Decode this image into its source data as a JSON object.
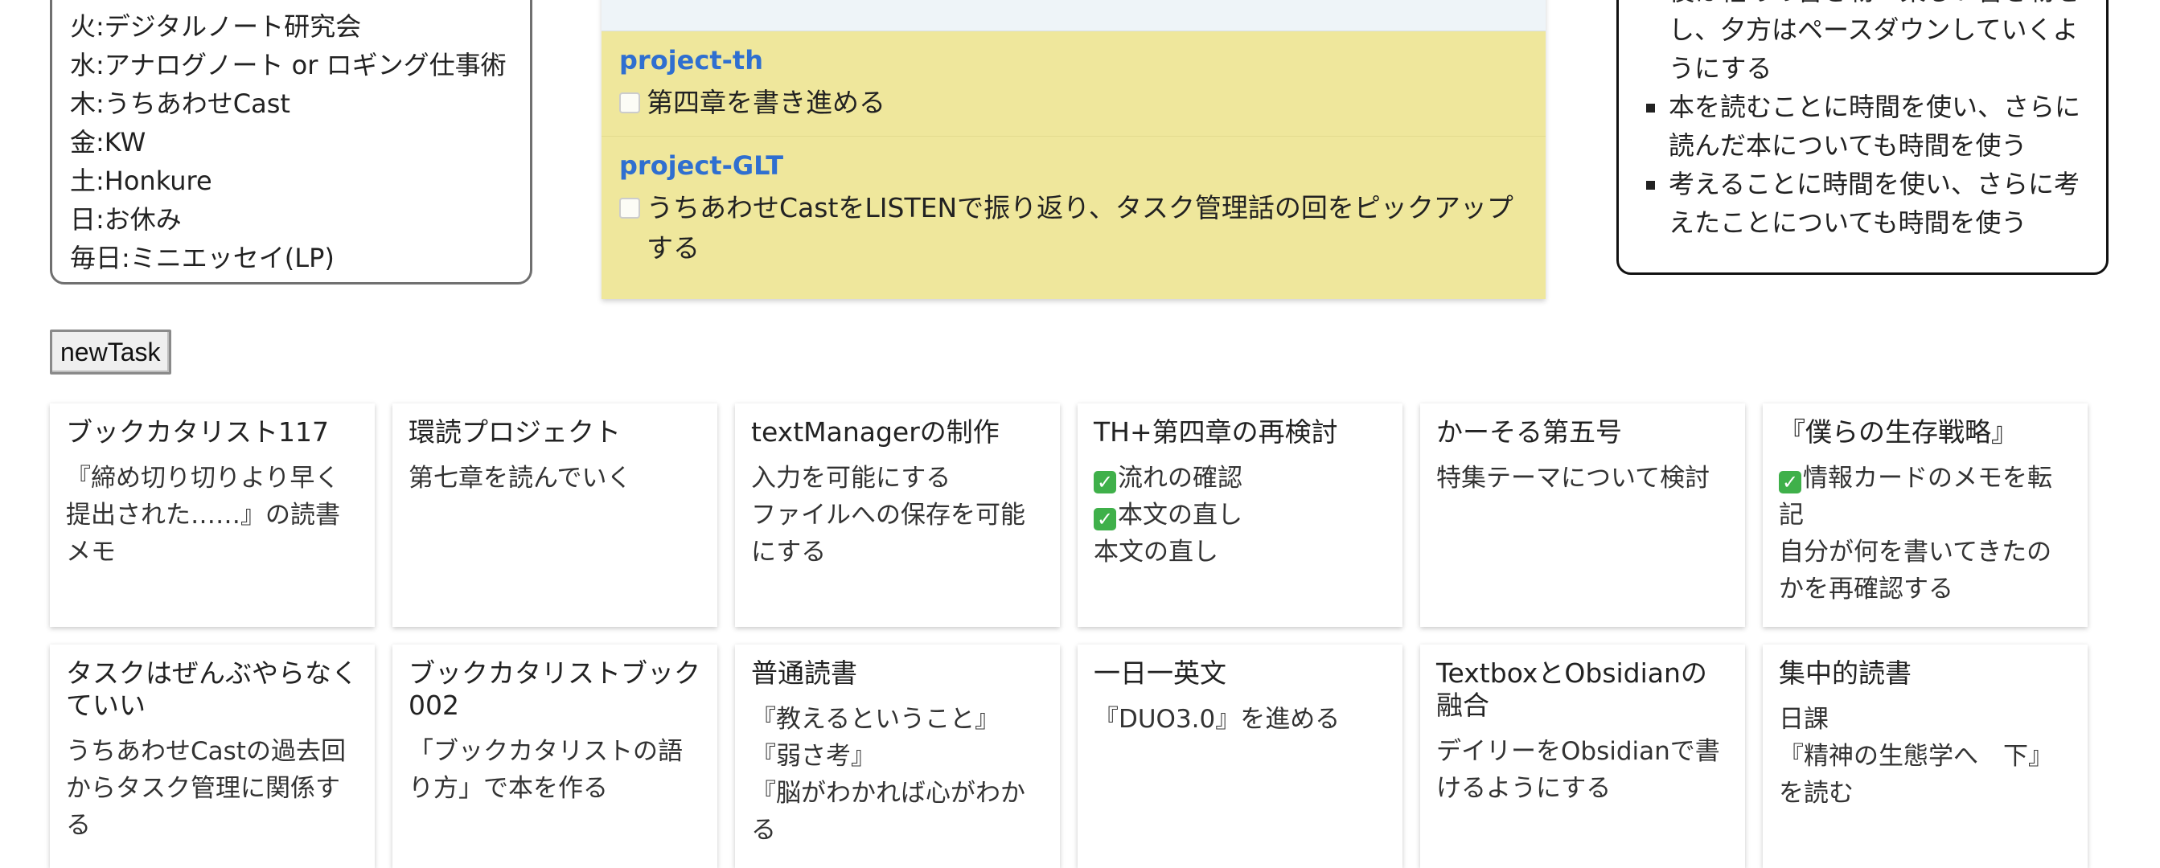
{
  "schedule": {
    "lines": [
      "火:デジタルノート研究会",
      "水:アナログノート or ロギング仕事術",
      "木:うちあわせCast",
      "金:KW",
      "土:Honkure",
      "日:お休み",
      "毎日:ミニエッセイ(LP)"
    ]
  },
  "projects": [
    {
      "name": "project-th",
      "task": "第四章を書き進める"
    },
    {
      "name": "project-GLT",
      "task": "うちあわせCastをLISTENで振り返り、タスク管理話の回をピックアップする"
    }
  ],
  "policy": {
    "items": [
      "後は軽めの書き物・楽しい書き物をし、夕方はペースダウンしていくようにする",
      "本を読むことに時間を使い、さらに読んだ本についても時間を使う",
      "考えることに時間を使い、さらに考えたことについても時間を使う"
    ]
  },
  "toolbar": {
    "new_task_label": "newTask"
  },
  "done_icon": {
    "glyph": "✓",
    "color": "#3fb04a"
  },
  "cards": [
    {
      "title": "ブックカタリスト117",
      "lines": [
        {
          "text": "『締め切り切りより早く提出された……』の読書メモ"
        }
      ]
    },
    {
      "title": "環読プロジェクト",
      "lines": [
        {
          "text": "第七章を読んでいく"
        }
      ]
    },
    {
      "title": "textManagerの制作",
      "lines": [
        {
          "text": "入力を可能にする"
        },
        {
          "text": "ファイルへの保存を可能にする"
        }
      ]
    },
    {
      "title": "TH+第四章の再検討",
      "lines": [
        {
          "text": "流れの確認",
          "done": true
        },
        {
          "text": "本文の直し",
          "done": true
        },
        {
          "text": "本文の直し"
        }
      ]
    },
    {
      "title": "かーそる第五号",
      "lines": [
        {
          "text": "特集テーマについて検討"
        }
      ]
    },
    {
      "title": "『僕らの生存戦略』",
      "lines": [
        {
          "text": "情報カードのメモを転記",
          "done": true
        },
        {
          "text": "自分が何を書いてきたのかを再確認する"
        }
      ]
    },
    {
      "title": "タスクはぜんぶやらなくていい",
      "lines": [
        {
          "text": "うちあわせCastの過去回からタスク管理に関係する"
        }
      ]
    },
    {
      "title": "ブックカタリストブック002",
      "lines": [
        {
          "text": "「ブックカタリストの語り方」で本を作る"
        }
      ]
    },
    {
      "title": "普通読書",
      "lines": [
        {
          "text": "『教えるということ』"
        },
        {
          "text": "『弱さ考』"
        },
        {
          "text": "『脳がわかれば心がわかる"
        }
      ]
    },
    {
      "title": "一日一英文",
      "lines": [
        {
          "text": "『DUO3.0』を進める"
        }
      ]
    },
    {
      "title": "TextboxとObsidianの融合",
      "lines": [
        {
          "text": "デイリーをObsidianで書けるようにする"
        }
      ]
    },
    {
      "title": "集中的読書",
      "lines": [
        {
          "text": "日課"
        },
        {
          "text": "『精神の生態学へ　下』を読む"
        }
      ]
    }
  ]
}
